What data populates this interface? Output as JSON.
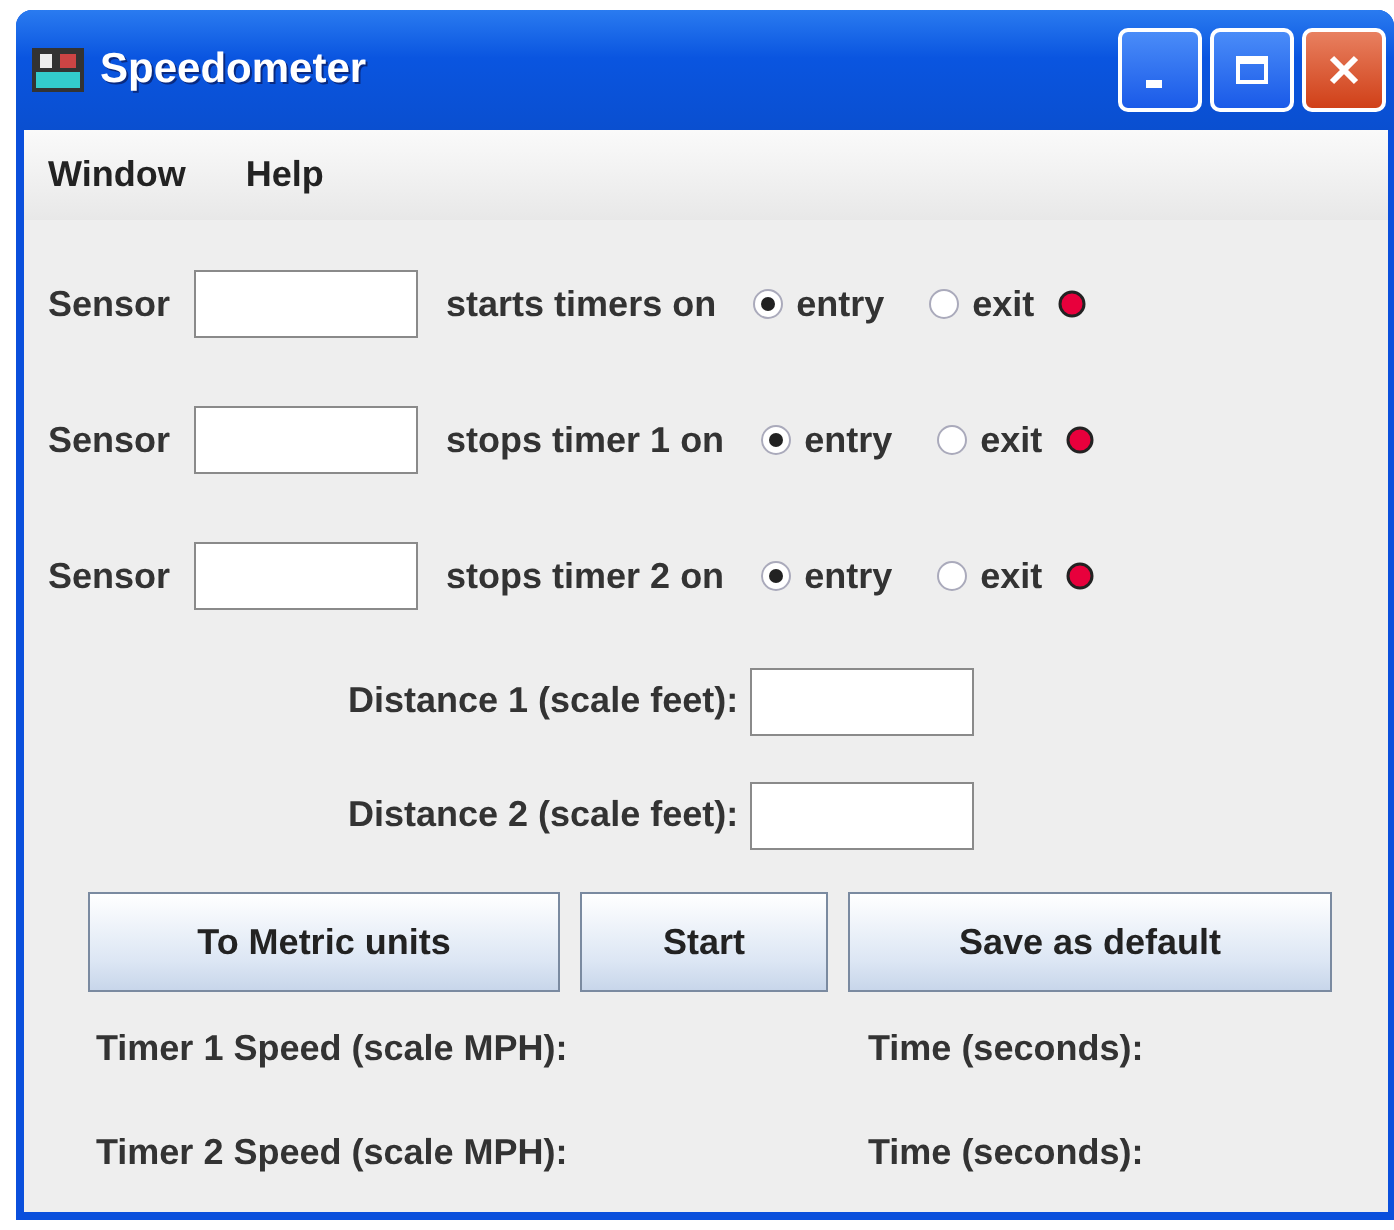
{
  "window": {
    "title": "Speedometer"
  },
  "menu": [
    "Window",
    "Help"
  ],
  "sensors": [
    {
      "label": "Sensor",
      "action": "starts timers on",
      "options": [
        {
          "label": "entry",
          "selected": true
        },
        {
          "label": "exit",
          "selected": false
        }
      ],
      "color": "#e8003c"
    },
    {
      "label": "Sensor",
      "action": "stops timer 1 on",
      "options": [
        {
          "label": "entry",
          "selected": true
        },
        {
          "label": "exit",
          "selected": false
        }
      ],
      "color": "#e8003c"
    },
    {
      "label": "Sensor",
      "action": "stops timer 2 on",
      "options": [
        {
          "label": "entry",
          "selected": true
        },
        {
          "label": "exit",
          "selected": false
        }
      ],
      "color": "#e8003c"
    }
  ],
  "distances": [
    "Distance 1 (scale feet):",
    "Distance 2 (scale feet):"
  ],
  "buttons": [
    "To Metric units",
    "Start",
    "Save as default"
  ],
  "results": [
    {
      "speed": "Timer 1 Speed (scale MPH):",
      "time": "Time (seconds):"
    },
    {
      "speed": "Timer 2 Speed (scale MPH):",
      "time": "Time (seconds):"
    }
  ]
}
